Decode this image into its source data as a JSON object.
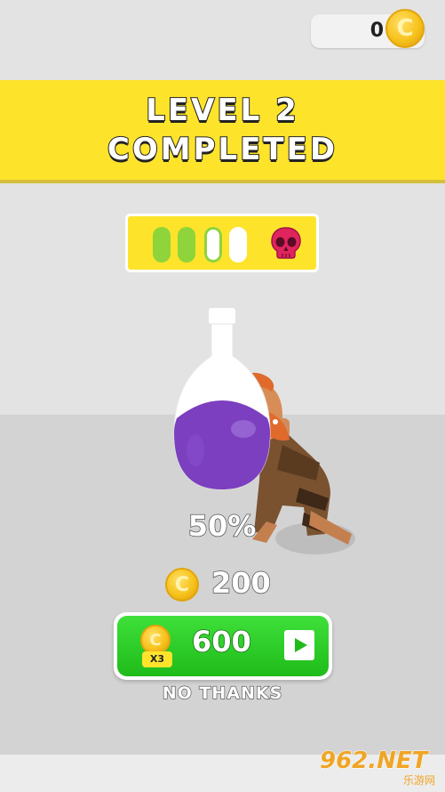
{
  "hud": {
    "coins": "0",
    "coin_symbol": "C"
  },
  "banner": {
    "line1": "LEVEL 2",
    "line2": "COMPLETED"
  },
  "level_progress": {
    "segments_completed": 3,
    "segments_total": 4,
    "boss_icon": "skull-icon"
  },
  "potion": {
    "fill_percent": 50,
    "label": "50%",
    "liquid_color": "#7b3fbf"
  },
  "reward": {
    "coins": "200",
    "coin_symbol": "C"
  },
  "multiply_button": {
    "value": "600",
    "badge": "X3",
    "coin_symbol": "C",
    "icon": "play-icon"
  },
  "no_thanks": "NO THANKS",
  "watermark": {
    "main": "962.NET",
    "sub": "乐游网"
  },
  "colors": {
    "banner": "#fde42b",
    "button_green": "#2ccf26",
    "skull": "#e0245e"
  }
}
